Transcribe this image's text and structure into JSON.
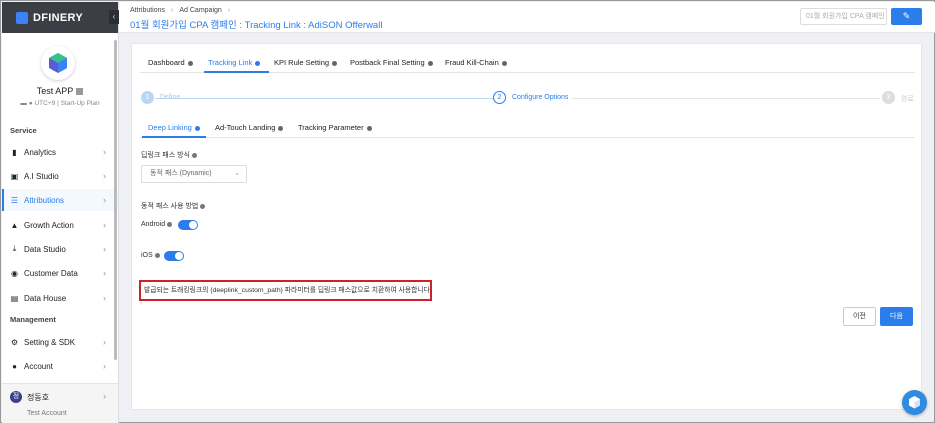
{
  "brand": {
    "name": "DFINERY",
    "accent": "#2b7de9"
  },
  "app": {
    "name": "Test APP",
    "timezone": "UTC+9",
    "plan": "Start-Up Plan"
  },
  "sidebar": {
    "sections": [
      {
        "label": "Service"
      },
      {
        "label": "Management"
      }
    ],
    "items": [
      {
        "label": "Analytics",
        "icon": "bar-chart-icon"
      },
      {
        "label": "A.I Studio",
        "icon": "ai-icon"
      },
      {
        "label": "Attributions",
        "icon": "list-icon",
        "active": true
      },
      {
        "label": "Growth Action",
        "icon": "growth-icon"
      },
      {
        "label": "Data Studio",
        "icon": "download-icon"
      },
      {
        "label": "Customer Data",
        "icon": "target-icon"
      },
      {
        "label": "Data House",
        "icon": "database-icon"
      },
      {
        "label": "Setting & SDK",
        "icon": "gear-icon"
      },
      {
        "label": "Account",
        "icon": "account-icon"
      }
    ],
    "user": {
      "avatar": "정",
      "name": "정동호",
      "sub": "Test Account"
    }
  },
  "header": {
    "breadcrumb": [
      "Attributions",
      "Ad Campaign"
    ],
    "title": "01월 회원가입 CPA 캠페인 : Tracking Link : AdiSON Offerwall",
    "search_placeholder": "01월 회원가입 CPA 캠페인",
    "edit_icon": "✎"
  },
  "main": {
    "tabs": [
      {
        "label": "Dashboard"
      },
      {
        "label": "Tracking Link",
        "active": true
      },
      {
        "label": "KPI Rule Setting"
      },
      {
        "label": "Postback Final Setting"
      },
      {
        "label": "Fraud Kill-Chain"
      }
    ],
    "steps": [
      {
        "num": "1",
        "label": "Define"
      },
      {
        "num": "2",
        "label": "Configure Options",
        "active": true
      },
      {
        "num": "3",
        "label": "완료"
      }
    ],
    "subtabs": [
      {
        "label": "Deep Linking",
        "active": true
      },
      {
        "label": "Ad-Touch Landing"
      },
      {
        "label": "Tracking Parameter"
      }
    ],
    "deeplink_method_label": "딥링크 패스 방식",
    "deeplink_method_value": "동적 패스 (Dynamic)",
    "dynamic_path_label": "동적 패스 사용 방법",
    "android_label": "Android",
    "android_enabled": true,
    "ios_label": "iOS",
    "ios_enabled": true,
    "notice": "발급되는 트래킹링크의 {deeplink_custom_path} 파라미터를 딥링크 패스값으로 치환하여 사용합니다.",
    "prev_label": "이전",
    "next_label": "다음"
  }
}
